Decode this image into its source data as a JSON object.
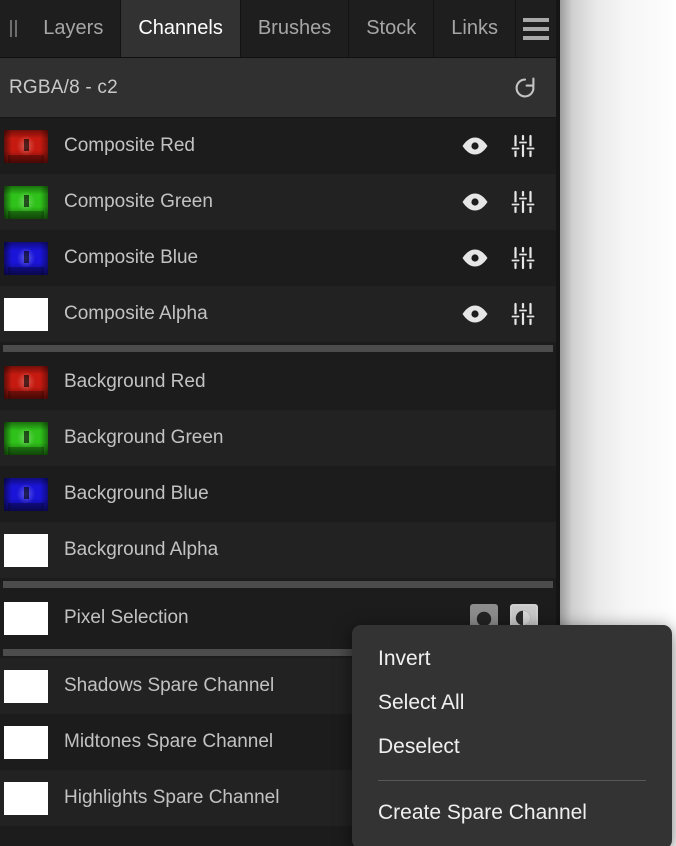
{
  "panel": {
    "tabs": [
      {
        "label": "Layers",
        "active": false
      },
      {
        "label": "Channels",
        "active": true
      },
      {
        "label": "Brushes",
        "active": false
      },
      {
        "label": "Stock",
        "active": false
      },
      {
        "label": "Links",
        "active": false
      }
    ],
    "grip_icon": "drag-handle-icon",
    "menu_icon": "hamburger-menu-icon",
    "subheader": {
      "title": "RGBA/8 - c2",
      "reset_icon": "reset-icon"
    }
  },
  "channels": {
    "groups": [
      {
        "name": "composite",
        "rows": [
          {
            "label": "Composite Red",
            "thumb": "photo",
            "tint": "#c61a10",
            "actions": [
              "visibility-icon",
              "adjust-icon"
            ]
          },
          {
            "label": "Composite Green",
            "thumb": "photo",
            "tint": "#2fc21a",
            "actions": [
              "visibility-icon",
              "adjust-icon"
            ]
          },
          {
            "label": "Composite Blue",
            "thumb": "photo",
            "tint": "#1a14d8",
            "actions": [
              "visibility-icon",
              "adjust-icon"
            ]
          },
          {
            "label": "Composite Alpha",
            "thumb": "white",
            "tint": "#ffffff",
            "actions": [
              "visibility-icon",
              "adjust-icon"
            ]
          }
        ]
      },
      {
        "name": "background",
        "rows": [
          {
            "label": "Background Red",
            "thumb": "photo",
            "tint": "#c61a10",
            "actions": []
          },
          {
            "label": "Background Green",
            "thumb": "photo",
            "tint": "#2fc21a",
            "actions": []
          },
          {
            "label": "Background Blue",
            "thumb": "photo",
            "tint": "#1a14d8",
            "actions": []
          },
          {
            "label": "Background Alpha",
            "thumb": "white",
            "tint": "#ffffff",
            "actions": []
          }
        ]
      },
      {
        "name": "selection",
        "rows": [
          {
            "label": "Pixel Selection",
            "thumb": "white",
            "tint": "#ffffff",
            "actions": [
              "selection-fill-icon",
              "selection-mask-icon"
            ]
          }
        ]
      },
      {
        "name": "spare",
        "rows": [
          {
            "label": "Shadows Spare Channel",
            "thumb": "white",
            "tint": "#ffffff",
            "actions": []
          },
          {
            "label": "Midtones Spare Channel",
            "thumb": "white",
            "tint": "#ffffff",
            "actions": []
          },
          {
            "label": "Highlights Spare Channel",
            "thumb": "white",
            "tint": "#ffffff",
            "actions": []
          }
        ]
      }
    ]
  },
  "context_menu": {
    "items": [
      {
        "label": "Invert",
        "separator_after": false
      },
      {
        "label": "Select All",
        "separator_after": false
      },
      {
        "label": "Deselect",
        "separator_after": true
      },
      {
        "label": "Create Spare Channel",
        "separator_after": false
      }
    ]
  },
  "colors": {
    "panel_bg": "#1c1c1c",
    "row_alt_bg": "#222222",
    "tab_active_bg": "#323232",
    "subheader_bg": "#303030",
    "menu_bg": "#333333",
    "separator": "#4c4c4c",
    "text": "#c2c2c2",
    "text_active": "#ffffff"
  }
}
